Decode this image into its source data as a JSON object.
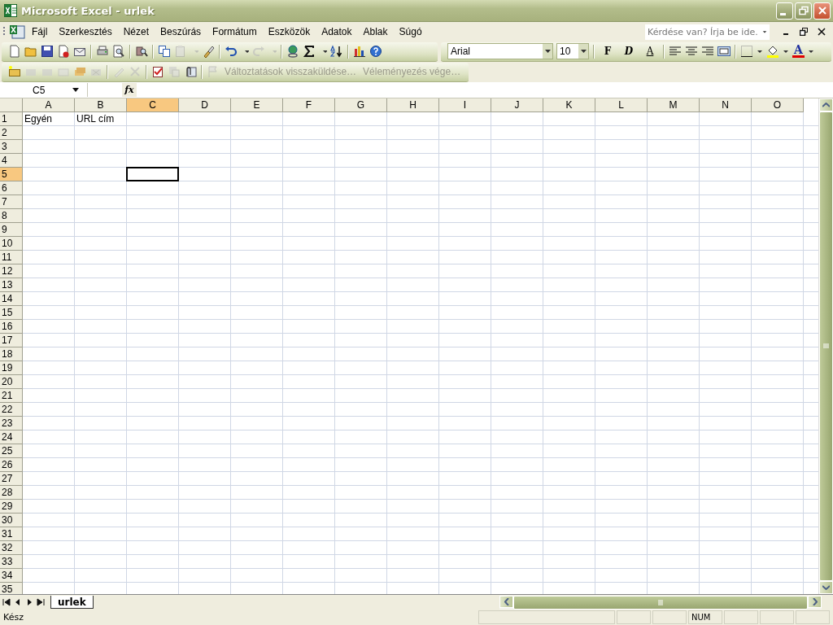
{
  "window": {
    "title": "Microsoft Excel - urlek"
  },
  "menu": [
    {
      "label": "Fájl"
    },
    {
      "label": "Szerkesztés"
    },
    {
      "label": "Nézet"
    },
    {
      "label": "Beszúrás"
    },
    {
      "label": "Formátum"
    },
    {
      "label": "Eszközök"
    },
    {
      "label": "Adatok"
    },
    {
      "label": "Ablak"
    },
    {
      "label": "Súgó"
    }
  ],
  "help_box": {
    "placeholder": "Kérdése van? Írja be ide."
  },
  "formatting": {
    "font": "Arial",
    "size": "10",
    "buttons": [
      {
        "label": "F",
        "kind": "bold"
      },
      {
        "label": "D",
        "kind": "italic"
      },
      {
        "label": "A",
        "kind": "underline"
      }
    ],
    "font_color_label": "A"
  },
  "review_toolbar": {
    "buttons": [
      {
        "label": "Változtatások visszaküldése…",
        "disabled": true
      },
      {
        "label": "Véleményezés vége…",
        "disabled": true
      }
    ]
  },
  "formula_bar": {
    "name_box": "C5",
    "fx": "fx"
  },
  "sheet": {
    "columns": [
      {
        "label": "A",
        "selected": false
      },
      {
        "label": "B",
        "selected": false
      },
      {
        "label": "C",
        "selected": true
      },
      {
        "label": "D",
        "selected": false
      },
      {
        "label": "E",
        "selected": false
      },
      {
        "label": "F",
        "selected": false
      },
      {
        "label": "G",
        "selected": false
      },
      {
        "label": "H",
        "selected": false
      },
      {
        "label": "I",
        "selected": false
      },
      {
        "label": "J",
        "selected": false
      },
      {
        "label": "K",
        "selected": false
      },
      {
        "label": "L",
        "selected": false
      },
      {
        "label": "M",
        "selected": false
      },
      {
        "label": "N",
        "selected": false
      },
      {
        "label": "O",
        "selected": false
      }
    ],
    "rows": [
      {
        "label": "1",
        "selected": false,
        "cells": [
          "Egyén",
          "URL cím"
        ]
      },
      {
        "label": "2",
        "selected": false
      },
      {
        "label": "3",
        "selected": false
      },
      {
        "label": "4",
        "selected": false
      },
      {
        "label": "5",
        "selected": true
      },
      {
        "label": "6",
        "selected": false
      },
      {
        "label": "7",
        "selected": false
      },
      {
        "label": "8",
        "selected": false
      },
      {
        "label": "9",
        "selected": false
      },
      {
        "label": "10",
        "selected": false
      },
      {
        "label": "11",
        "selected": false
      },
      {
        "label": "12",
        "selected": false
      },
      {
        "label": "13",
        "selected": false
      },
      {
        "label": "14",
        "selected": false
      },
      {
        "label": "15",
        "selected": false
      },
      {
        "label": "16",
        "selected": false
      },
      {
        "label": "17",
        "selected": false
      },
      {
        "label": "18",
        "selected": false
      },
      {
        "label": "19",
        "selected": false
      },
      {
        "label": "20",
        "selected": false
      },
      {
        "label": "21",
        "selected": false
      },
      {
        "label": "22",
        "selected": false
      },
      {
        "label": "23",
        "selected": false
      },
      {
        "label": "24",
        "selected": false
      },
      {
        "label": "25",
        "selected": false
      },
      {
        "label": "26",
        "selected": false
      },
      {
        "label": "27",
        "selected": false
      },
      {
        "label": "28",
        "selected": false
      },
      {
        "label": "29",
        "selected": false
      },
      {
        "label": "30",
        "selected": false
      },
      {
        "label": "31",
        "selected": false
      },
      {
        "label": "32",
        "selected": false
      },
      {
        "label": "33",
        "selected": false
      },
      {
        "label": "34",
        "selected": false
      },
      {
        "label": "35",
        "selected": false
      }
    ]
  },
  "sheet_tabs": [
    {
      "label": "urlek",
      "selected": true
    }
  ],
  "status_bar": {
    "text": "Kész",
    "indicators": [
      "NUM"
    ]
  }
}
